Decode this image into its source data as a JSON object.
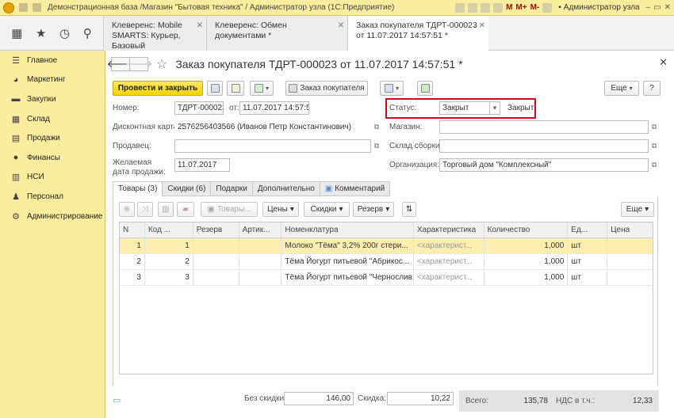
{
  "app": {
    "title": "Демонстрационная база /Магазин \"Бытовая техника\" / Администратор узла  (1С:Предприятие)",
    "user": "Администратор узла",
    "m": "M",
    "mplus": "M+",
    "mminus": "M-"
  },
  "tabs": [
    {
      "label": "Клеверенс: Mobile SMARTS: Курьер, Базовый"
    },
    {
      "label": "Клеверенс: Обмен документами *"
    },
    {
      "label": "Заказ покупателя ТДРТ-000023 от 11.07.2017 14:57:51 *"
    }
  ],
  "sidebar": {
    "items": [
      {
        "label": "Главное",
        "icon": "list-icon"
      },
      {
        "label": "Маркетинг",
        "icon": "pie-icon"
      },
      {
        "label": "Закупки",
        "icon": "truck-icon"
      },
      {
        "label": "Склад",
        "icon": "grid-icon"
      },
      {
        "label": "Продажи",
        "icon": "cart-icon"
      },
      {
        "label": "Финансы",
        "icon": "coins-icon"
      },
      {
        "label": "НСИ",
        "icon": "catalog-icon"
      },
      {
        "label": "Персонал",
        "icon": "person-icon"
      },
      {
        "label": "Администрирование",
        "icon": "gear-icon"
      }
    ]
  },
  "form": {
    "title": "Заказ покупателя ТДРТ-000023 от 11.07.2017 14:57:51 *",
    "toolbar": {
      "post_close": "Провести и закрыть",
      "order_print": "Заказ покупателя",
      "more": "Еще",
      "help": "?"
    },
    "number_label": "Номер:",
    "number": "ТДРТ-000023",
    "from_label": "от:",
    "date": "11.07.2017 14:57:51",
    "status_label": "Статус:",
    "status": "Закрыт",
    "status_text": "Закрыт",
    "card_label": "Дисконтная карта:",
    "card": "2576256403566 (Иванов  Петр  Константинович)",
    "shop_label": "Магазин:",
    "shop": "",
    "seller_label": "Продавец:",
    "seller": "",
    "warehouse_label": "Склад сборки:",
    "warehouse": "",
    "desired_label": "Желаемая дата продажи:",
    "desired": "11.07.2017",
    "org_label": "Организация:",
    "org": "Торговый дом \"Комплексный\""
  },
  "subtabs": [
    {
      "label": "Товары (3)"
    },
    {
      "label": "Скидки (6)"
    },
    {
      "label": "Подарки"
    },
    {
      "label": "Дополнительно"
    },
    {
      "label": "Комментарий"
    }
  ],
  "table_toolbar": {
    "goods": "Товары...",
    "prices": "Цены",
    "discounts": "Скидки",
    "reserve": "Резерв",
    "more": "Еще"
  },
  "table": {
    "columns": [
      "N",
      "Код ...",
      "Резерв",
      "Артик...",
      "Номенклатура",
      "Характеристика",
      "Количество",
      "Ед...",
      "Цена"
    ],
    "rows": [
      [
        "1",
        "1",
        "",
        "",
        "Молоко \"Тёма\" 3,2% 200г стери...",
        "<характерист...",
        "1,000",
        "шт",
        ""
      ],
      [
        "2",
        "2",
        "",
        "",
        "Тёма Йогурт питьевой \"Абрикос...",
        "<характерист...",
        "1,000",
        "шт",
        ""
      ],
      [
        "3",
        "3",
        "",
        "",
        "Тёма Йогурт питьевой \"Чернослив...",
        "<характерист...",
        "1,000",
        "шт",
        ""
      ]
    ]
  },
  "footer": {
    "no_discount_label": "Без скидки:",
    "no_discount": "146,00",
    "discount_label": "Скидка:",
    "discount": "10,22",
    "total_label": "Всего:",
    "total": "135,78",
    "vat_label": "НДС в т.ч.:",
    "vat": "12,33"
  }
}
